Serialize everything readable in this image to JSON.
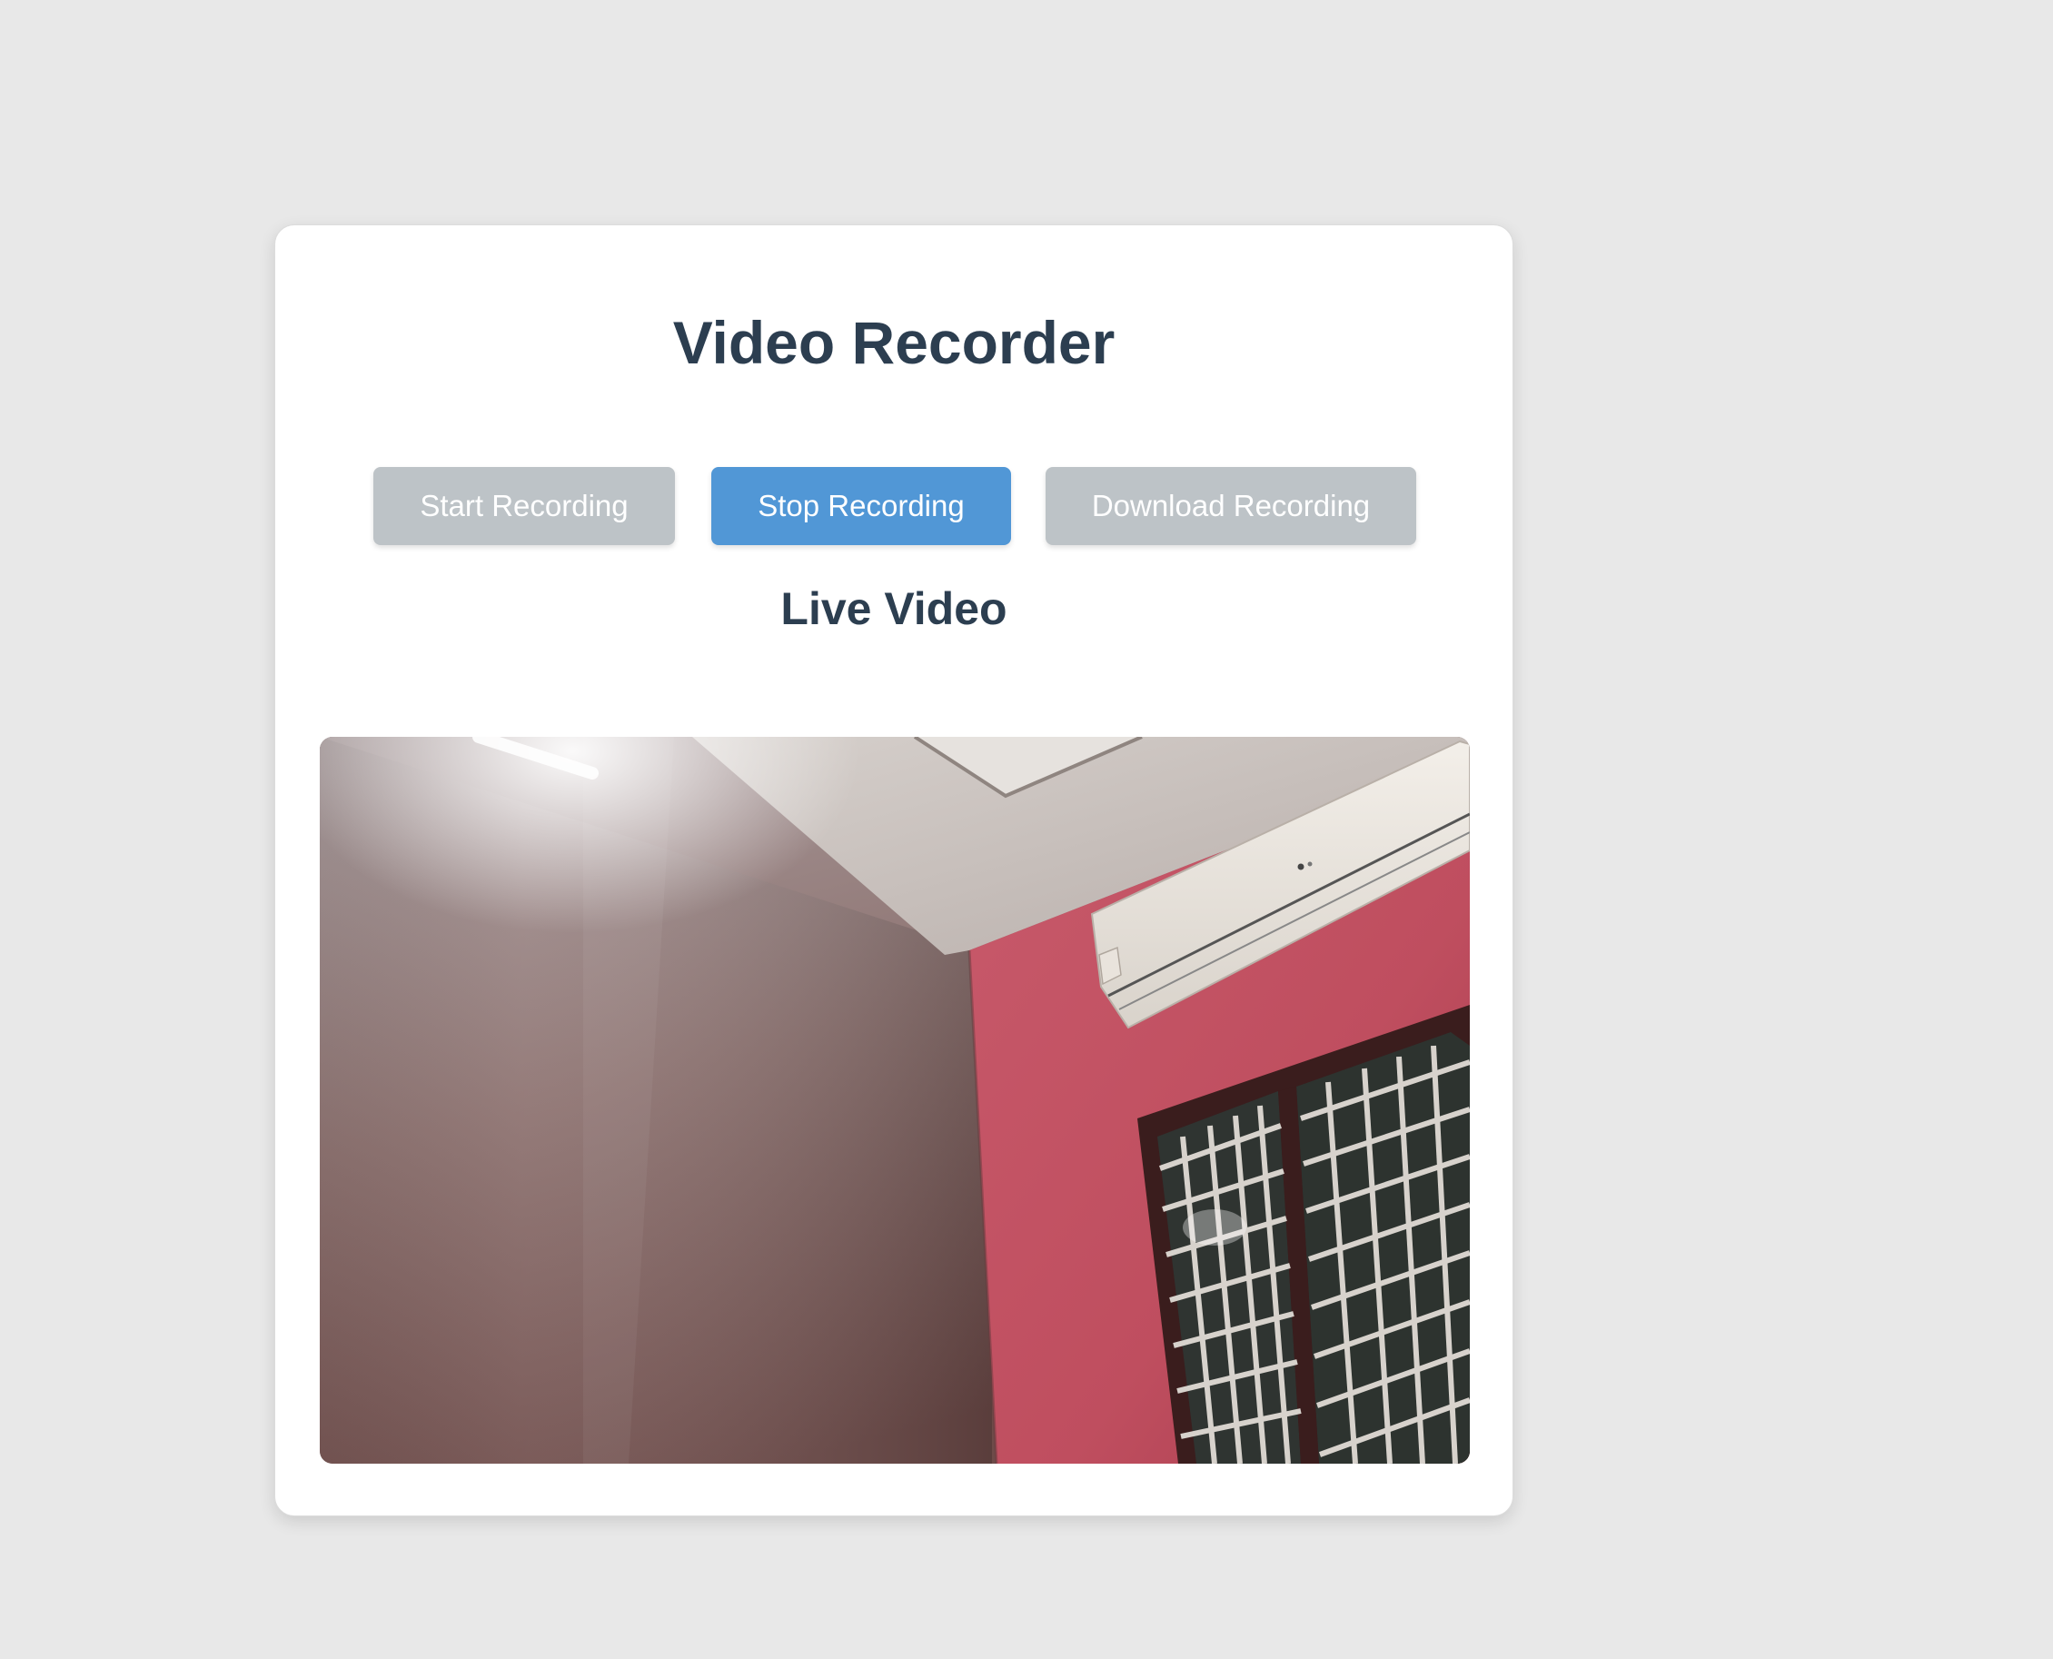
{
  "app": {
    "title": "Video Recorder"
  },
  "controls": {
    "start_label": "Start Recording",
    "stop_label": "Stop Recording",
    "download_label": "Download Recording",
    "start_enabled": false,
    "stop_enabled": true,
    "download_enabled": false
  },
  "live": {
    "heading": "Live Video"
  },
  "colors": {
    "background": "#e8e8e8",
    "card": "#ffffff",
    "heading_text": "#2c3e50",
    "button_active": "#5197d6",
    "button_disabled": "#bdc3c7"
  }
}
